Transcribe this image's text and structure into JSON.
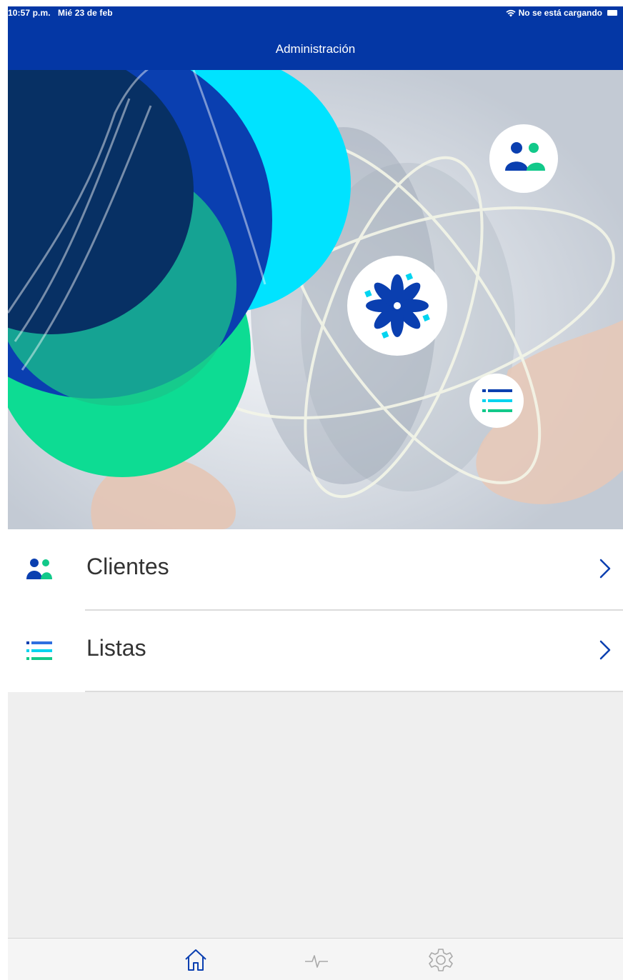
{
  "status_bar": {
    "time": "10:57 p.m.",
    "date": "Mié 23 de feb",
    "charging": "No se está cargando"
  },
  "nav": {
    "title": "Administración"
  },
  "menu": {
    "items": [
      {
        "label": "Clientes",
        "icon": "users-icon"
      },
      {
        "label": "Listas",
        "icon": "list-icon"
      }
    ]
  },
  "tab_bar": {
    "tabs": [
      {
        "icon": "home-icon",
        "active": true
      },
      {
        "icon": "activity-icon",
        "active": false
      },
      {
        "icon": "gear-icon",
        "active": false
      }
    ]
  },
  "colors": {
    "header": "#0437a5",
    "accent_green": "#12c98a",
    "accent_cyan": "#00e0ff",
    "dark_navy": "#07305e"
  }
}
